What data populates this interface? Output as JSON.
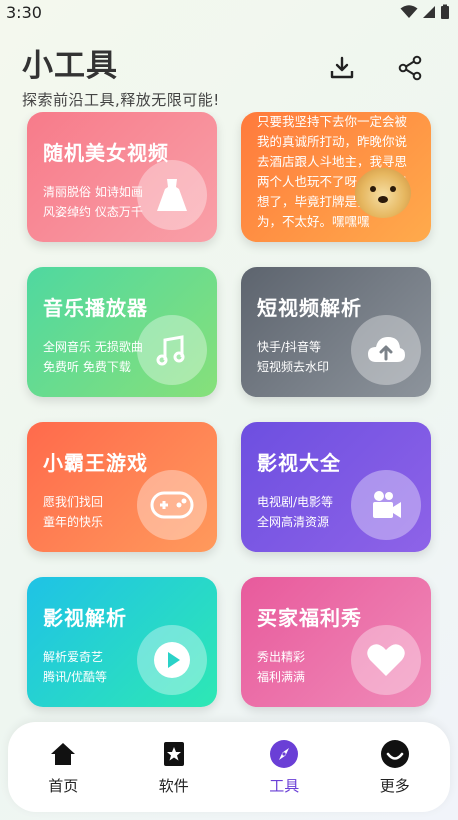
{
  "status": {
    "time": "3:30"
  },
  "header": {
    "title": "小工具",
    "subtitle": "探索前沿工具,释放无限可能!",
    "download_icon": "download-icon",
    "share_icon": "share-icon"
  },
  "cards": [
    {
      "title": "随机美女视频",
      "desc": [
        "清丽脱俗 如诗如画",
        "风姿绰约 仪态万千"
      ],
      "icon": "dress-icon",
      "colors": [
        "#f77b8a",
        "#f9a0a8"
      ]
    },
    {
      "title": "",
      "desc": [
        "只要我坚持下去你一定会被",
        "我的真诚所打动，昨晚你说",
        "去酒店跟人斗地主，我寻思",
        "两个人也玩不了呀，我想了",
        "想了，毕竟打牌是我的",
        "为，不太好。嘿嘿嘿"
      ],
      "icon": "doge-icon",
      "colors": [
        "#ff7a3c",
        "#ffab4c"
      ]
    },
    {
      "title": "音乐播放器",
      "desc": [
        "全网音乐 无损歌曲",
        "免费听 免费下载"
      ],
      "icon": "music-icon",
      "colors": [
        "#4fd8a0",
        "#87e07a"
      ]
    },
    {
      "title": "短视频解析",
      "desc": [
        "快手/抖音等",
        "短视频去水印"
      ],
      "icon": "cloud-upload-icon",
      "colors": [
        "#5d646e",
        "#8d949c"
      ]
    },
    {
      "title": "小霸王游戏",
      "desc": [
        "愿我们找回",
        "童年的快乐"
      ],
      "icon": "gamepad-icon",
      "colors": [
        "#ff6a4c",
        "#ff9a5c"
      ]
    },
    {
      "title": "影视大全",
      "desc": [
        "电视剧/电影等",
        "全网高清资源"
      ],
      "icon": "video-camera-icon",
      "colors": [
        "#6d4fe0",
        "#8e63e8"
      ]
    },
    {
      "title": "影视解析",
      "desc": [
        "解析爱奇艺",
        "腾讯/优酷等"
      ],
      "icon": "play-icon",
      "colors": [
        "#1fc2e6",
        "#2ee8b4"
      ]
    },
    {
      "title": "买家福利秀",
      "desc": [
        "秀出精彩",
        "福利满满"
      ],
      "icon": "heart-icon",
      "colors": [
        "#e85a9c",
        "#f08ab8"
      ]
    }
  ],
  "nav": [
    {
      "label": "首页",
      "icon": "home-icon",
      "active": false
    },
    {
      "label": "软件",
      "icon": "bookmark-star-icon",
      "active": false
    },
    {
      "label": "工具",
      "icon": "compass-icon",
      "active": true
    },
    {
      "label": "更多",
      "icon": "smile-icon",
      "active": false
    }
  ],
  "colors": {
    "accent": "#6a3fd6"
  }
}
